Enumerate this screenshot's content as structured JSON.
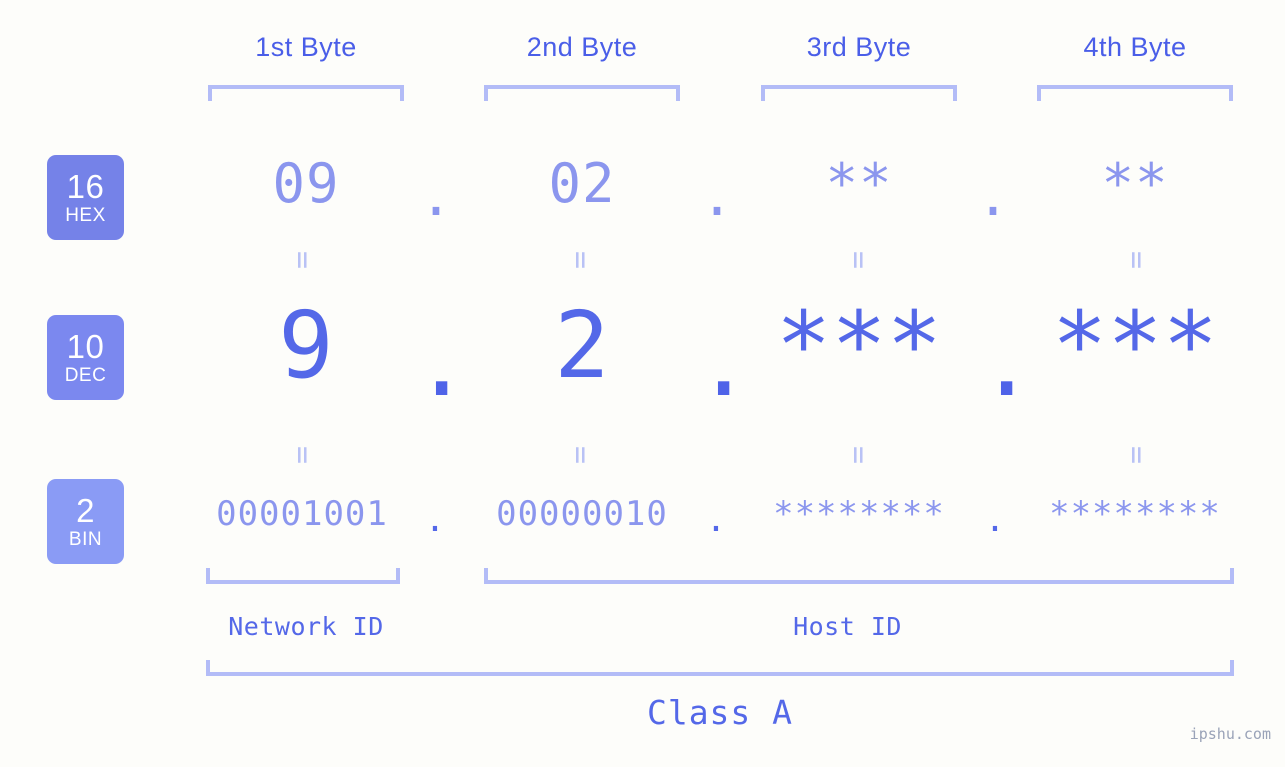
{
  "page": {
    "background_color": "#fdfdfa",
    "watermark": "ipshu.com"
  },
  "colors": {
    "accent_strong": "#5468e8",
    "accent_light": "#8b96ee",
    "bracket": "#b3bcf7",
    "equals": "#b9c2f5",
    "badge_hex": "#7582e8",
    "badge_dec": "#7b88ef",
    "badge_bin": "#8a9bf5",
    "badge_text": "#ffffff"
  },
  "byte_headers": [
    {
      "label": "1st Byte"
    },
    {
      "label": "2nd Byte"
    },
    {
      "label": "3rd Byte"
    },
    {
      "label": "4th Byte"
    }
  ],
  "radix_badges": [
    {
      "number": "16",
      "name": "HEX"
    },
    {
      "number": "10",
      "name": "DEC"
    },
    {
      "number": "2",
      "name": "BIN"
    }
  ],
  "separators": {
    "dot": ".",
    "equals": "="
  },
  "rows": {
    "hex": {
      "radix": "16",
      "radix_name": "HEX",
      "values": [
        "09",
        "02",
        "**",
        "**"
      ]
    },
    "dec": {
      "radix": "10",
      "radix_name": "DEC",
      "values": [
        "9",
        "2",
        "***",
        "***"
      ]
    },
    "bin": {
      "radix": "2",
      "radix_name": "BIN",
      "values": [
        "00001001",
        "00000010",
        "********",
        "********"
      ]
    }
  },
  "sections": {
    "network_id": "Network ID",
    "host_id": "Host ID",
    "class": "Class A"
  }
}
